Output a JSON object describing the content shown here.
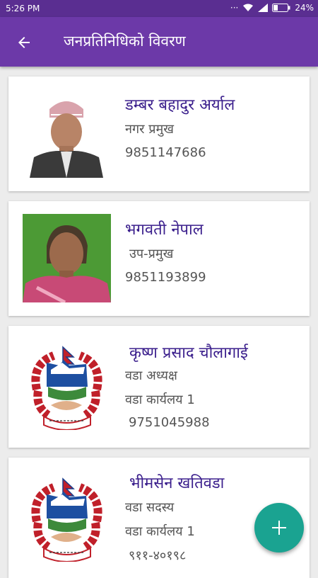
{
  "status_bar": {
    "time": "5:26 PM",
    "battery": "24%",
    "icons": [
      "dots-icon",
      "wifi-icon",
      "signal-icon",
      "battery-icon"
    ]
  },
  "app_bar": {
    "title": "जनप्रतिनिधिको विवरण",
    "back_icon": "arrow-left-icon"
  },
  "representatives": [
    {
      "name": "डम्बर बहादुर अर्याल",
      "lines": [
        "नगर प्रमुख",
        "9851147686"
      ],
      "photo": "man-portrait"
    },
    {
      "name": "भगवती नेपाल",
      "lines": [
        "उप-प्रमुख",
        "9851193899"
      ],
      "photo": "woman-portrait"
    },
    {
      "name": "कृष्ण प्रसाद चौलागाई",
      "lines": [
        "वडा अध्यक्ष",
        "वडा कार्यलय 1",
        "9751045988"
      ],
      "photo": "nepal-emblem"
    },
    {
      "name": "भीमसेन खतिवडा",
      "lines": [
        "वडा सदस्य",
        "वडा कार्यलय 1",
        "९११-४०१९८"
      ],
      "photo": "nepal-emblem"
    }
  ],
  "emblem_text": "जननी जन्मभूमिश्च स्वर्गादपि गरीयसी",
  "fab": {
    "icon": "plus-icon",
    "label": "+"
  },
  "colors": {
    "status_bar": "#5a2e91",
    "app_bar": "#6c39a8",
    "name_text": "#3a1e8c",
    "fab": "#1aa391"
  }
}
